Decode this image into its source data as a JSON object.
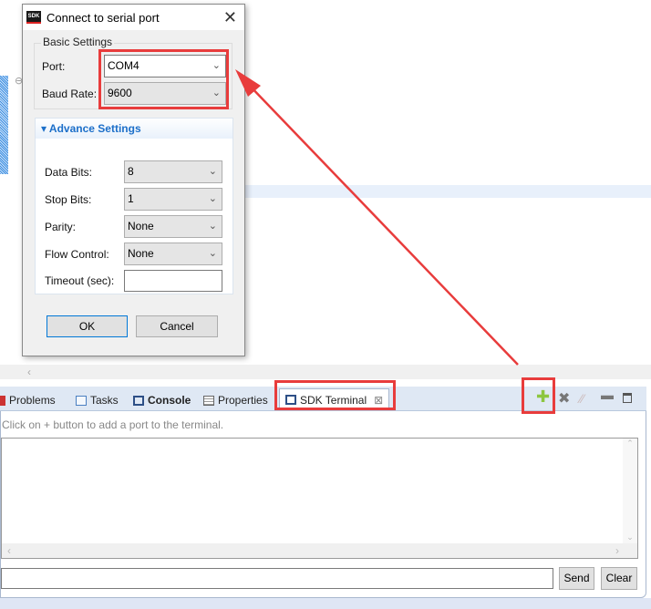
{
  "dialog": {
    "title": "Connect to serial port",
    "icon": "sdk-logo",
    "basic_legend": "Basic Settings",
    "port_label": "Port:",
    "port_value": "COM4",
    "baud_label": "Baud Rate:",
    "baud_value": "9600",
    "advance_title": "Advance Settings",
    "data_bits_label": "Data Bits:",
    "data_bits_value": "8",
    "stop_bits_label": "Stop Bits:",
    "stop_bits_value": "1",
    "parity_label": "Parity:",
    "parity_value": "None",
    "flow_label": "Flow Control:",
    "flow_value": "None",
    "timeout_label": "Timeout (sec):",
    "timeout_value": "",
    "ok": "OK",
    "cancel": "Cancel"
  },
  "tabs": [
    {
      "label": "Problems"
    },
    {
      "label": "Tasks"
    },
    {
      "label": "Console"
    },
    {
      "label": "Properties"
    },
    {
      "label": "SDK Terminal",
      "active": true
    }
  ],
  "terminal": {
    "hint": "Click on + button to add a port to the terminal.",
    "input_value": "",
    "send": "Send",
    "clear": "Clear"
  },
  "colors": {
    "annotation": "#e83c3c",
    "accent": "#1c6fc9",
    "add_icon": "#8cc63f"
  }
}
